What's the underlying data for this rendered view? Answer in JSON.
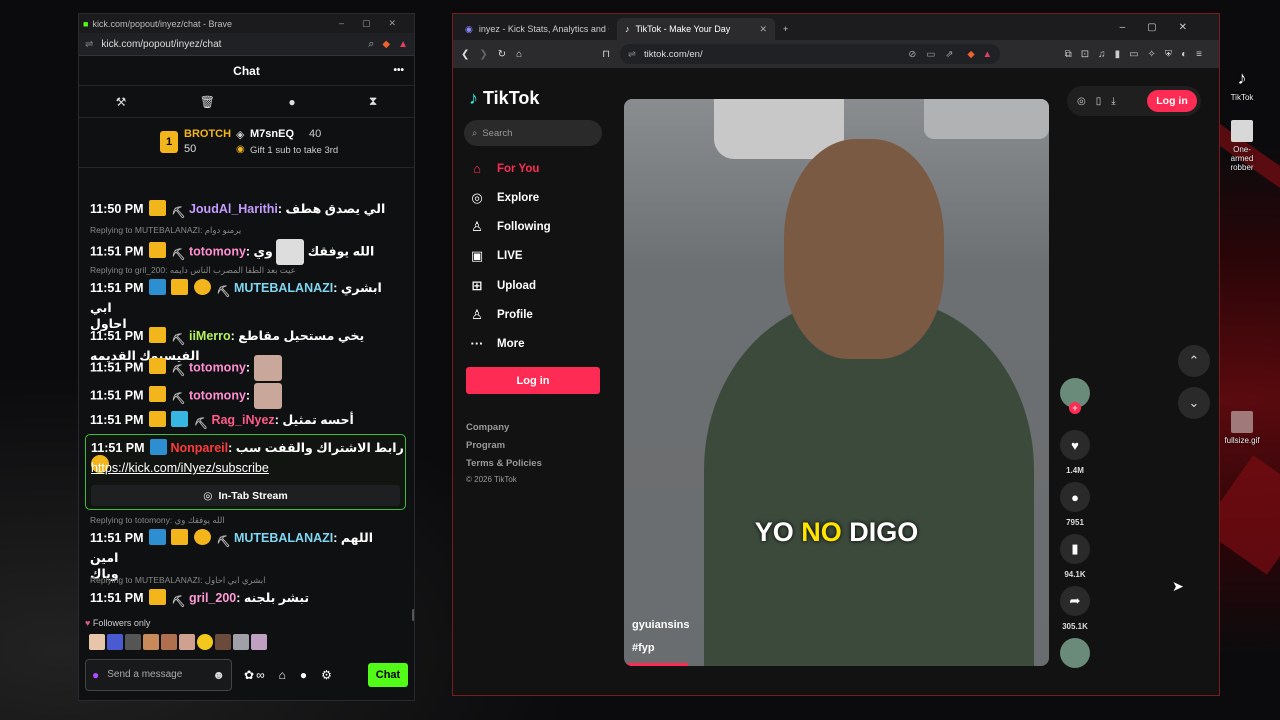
{
  "chat_window": {
    "title": "kick.com/popout/inyez/chat - Brave",
    "url": "kick.com/popout/inyez/chat",
    "header": "Chat",
    "menu": "•••",
    "leaderboard": {
      "rank1_name": "BROTCH",
      "rank1_count": "50",
      "rank2_name": "M7snEQ",
      "rank2_count": "40",
      "gift_text": "Gift 1 sub to take 3rd"
    },
    "messages": [
      {
        "time": "11:50 PM",
        "user": "JoudAl_Harithi",
        "text": "الي يصدق هطف",
        "color": "#c49cff"
      },
      {
        "reply": "Replying to MUTEBALANAZI: يرمنو دوام",
        "time": "11:51 PM",
        "user": "totomony",
        "text": "الله يوفقك",
        "tail": "وي",
        "color": "#ff8fd0"
      },
      {
        "reply": "Replying to gril_200: عيت بعد الطفا المصرب الناس دايمه",
        "time": "11:51 PM",
        "user": "MUTEBALANAZI",
        "text": "ابشري ابي",
        "text2": "احاول",
        "color": "#7fd6f2"
      },
      {
        "time": "11:51 PM",
        "user": "iiMerro",
        "text": "يخي مستحيل مقاطع الفيسبوك القديمه",
        "color": "#b4f25c"
      },
      {
        "time": "11:51 PM",
        "user": "totomony",
        "text": "",
        "color": "#ff8fd0"
      },
      {
        "time": "11:51 PM",
        "user": "totomony",
        "text": "",
        "color": "#ff8fd0"
      },
      {
        "time": "11:51 PM",
        "user": "Rag_iNyez",
        "text": "أحسه تمثيل",
        "color": "#ff5b8a"
      },
      {
        "reply": "Replying to totomony: الله يوفقك وي",
        "time": "11:51 PM",
        "user": "MUTEBALANAZI",
        "text": "اللهم امين",
        "text2": "وياك",
        "color": "#7fd6f2"
      },
      {
        "reply": "Replying to MUTEBALANAZI: ابشري ابي احاول",
        "time": "11:51 PM",
        "user": "gril_200",
        "text": "تبشر بلجنه",
        "color": "#ff9bd6"
      }
    ],
    "pinned": {
      "time": "11:51 PM",
      "user": "Nonpareil",
      "text": "رابط الاشتراك والقفت سب",
      "link": "https://kick.com/iNyez/subscribe",
      "stream_label": "In-Tab Stream"
    },
    "followers_only": "Followers only",
    "input_placeholder": "Send a message",
    "chat_button": "Chat"
  },
  "browser": {
    "tab1": "inyez - Kick Stats, Analytics and Char",
    "tab2": "TikTok - Make Your Day",
    "new_tab": "+",
    "url": "tiktok.com/en/"
  },
  "tiktok": {
    "logo": "TikTok",
    "search_placeholder": "Search",
    "nav": [
      "For You",
      "Explore",
      "Following",
      "LIVE",
      "Upload",
      "Profile",
      "More"
    ],
    "login": "Log in",
    "footer": [
      "Company",
      "Program",
      "Terms & Policies",
      "© 2026 TikTok"
    ],
    "video": {
      "caption_pre": "YO",
      "caption_hl": "NO",
      "caption_post": "DIGO",
      "username": "gyuiansins",
      "tag": "#fyp"
    },
    "actions": {
      "likes": "1.4M",
      "comments": "7951",
      "saves": "94.1K",
      "shares": "305.1K"
    },
    "top_login": "Log in"
  },
  "desktop": {
    "icon1": "TikTok",
    "icon2": "One-armed robber",
    "icon3": "fullsize.gif"
  },
  "colors": {
    "kick_green": "#53fc18",
    "tiktok_red": "#fe2c55"
  }
}
